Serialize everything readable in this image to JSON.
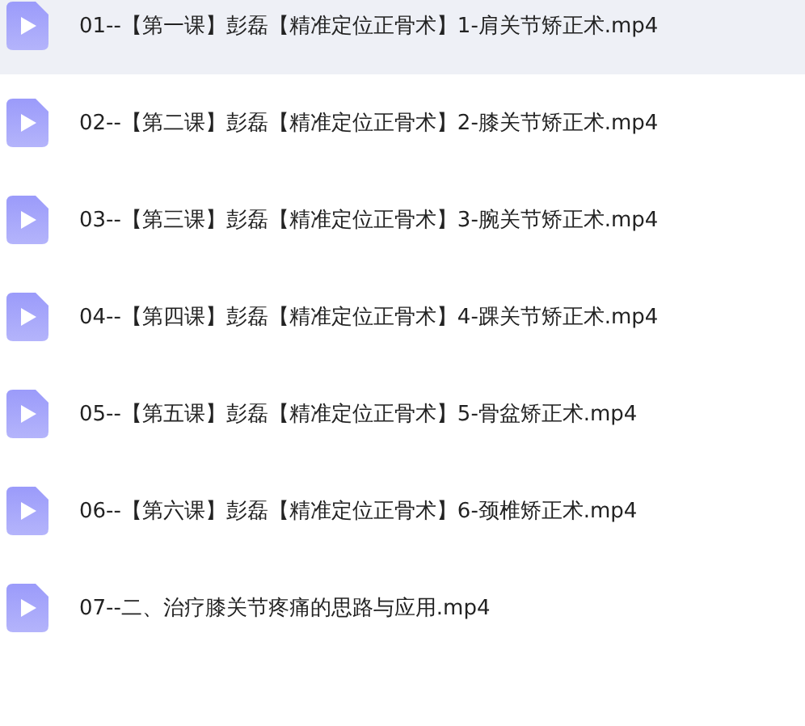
{
  "files": [
    {
      "name": "01--【第一课】彭磊【精准定位正骨术】1-肩关节矫正术.mp4",
      "selected": true
    },
    {
      "name": "02--【第二课】彭磊【精准定位正骨术】2-膝关节矫正术.mp4",
      "selected": false
    },
    {
      "name": "03--【第三课】彭磊【精准定位正骨术】3-腕关节矫正术.mp4",
      "selected": false
    },
    {
      "name": "04--【第四课】彭磊【精准定位正骨术】4-踝关节矫正术.mp4",
      "selected": false
    },
    {
      "name": "05--【第五课】彭磊【精准定位正骨术】5-骨盆矫正术.mp4",
      "selected": false
    },
    {
      "name": "06--【第六课】彭磊【精准定位正骨术】6-颈椎矫正术.mp4",
      "selected": false
    },
    {
      "name": "07--二、治疗膝关节疼痛的思路与应用.mp4",
      "selected": false
    }
  ]
}
